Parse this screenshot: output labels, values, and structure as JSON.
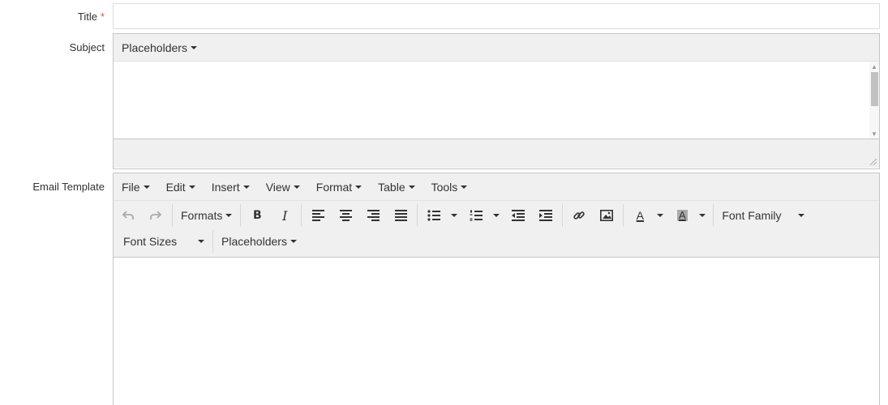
{
  "labels": {
    "title": "Title",
    "required_mark": "*",
    "subject": "Subject",
    "email_template": "Email Template"
  },
  "title_field": {
    "value": "",
    "placeholder": ""
  },
  "subject_editor": {
    "placeholders_menu": "Placeholders"
  },
  "email_editor": {
    "menu": [
      "File",
      "Edit",
      "Insert",
      "View",
      "Format",
      "Table",
      "Tools"
    ],
    "toolbar": {
      "formats_label": "Formats",
      "bold_glyph": "B",
      "italic_glyph": "I",
      "font_family_label": "Font Family",
      "font_sizes_label": "Font Sizes",
      "placeholders_label": "Placeholders",
      "text_color_glyph": "A",
      "bg_color_glyph": "A"
    }
  },
  "colors": {
    "toolbar_bg": "#f0f0f0",
    "border": "#c5c5c5",
    "required": "#d9534f"
  }
}
